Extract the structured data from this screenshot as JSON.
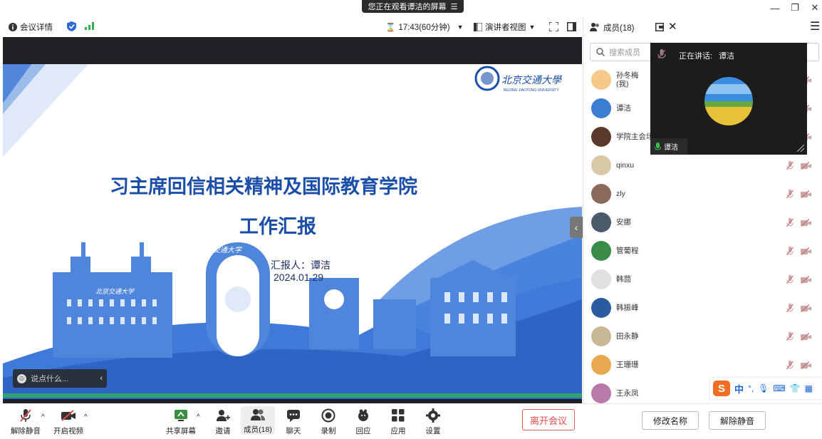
{
  "banner": {
    "text": "您正在观看谭洁的屏幕"
  },
  "toolbar": {
    "meeting_info": "会议详情",
    "timer": "17:43(60分钟)",
    "view_mode": "演讲者视图"
  },
  "slide": {
    "title_line1": "习主席回信相关精神及国际教育学院",
    "title_line2": "工作汇报",
    "reporter": "汇报人：谭洁",
    "date": "2024.01.29",
    "logo_text": "北京交通大學",
    "logo_sub": "BEIJING JIAOTONG UNIVERSITY",
    "building_caption": "北京交通大学",
    "arch_caption": "交通大学"
  },
  "chat_input": {
    "placeholder": "说点什么..."
  },
  "bottom_bar": {
    "unmute": "解除静音",
    "start_video": "开启视频",
    "share_screen": "共享屏幕",
    "invite": "邀请",
    "members": "成员(18)",
    "chat": "聊天",
    "record": "录制",
    "reactions": "回应",
    "apps": "应用",
    "settings": "设置",
    "leave": "离开会议"
  },
  "panel": {
    "title": "成员(18)",
    "search_placeholder": "搜索成员",
    "speaking_label": "正在讲话:",
    "speaking_name": "谭洁",
    "video_name": "谭洁",
    "rename_button": "修改名称",
    "unmute_button": "解除静音",
    "members": [
      {
        "name": "孙冬梅",
        "sub": "(我)"
      },
      {
        "name": "谭洁",
        "sub": ""
      },
      {
        "name": "学院主会场",
        "sub": ""
      },
      {
        "name": "qinxu",
        "sub": ""
      },
      {
        "name": "zly",
        "sub": ""
      },
      {
        "name": "安娜",
        "sub": ""
      },
      {
        "name": "管葡程",
        "sub": ""
      },
      {
        "name": "韩茴",
        "sub": ""
      },
      {
        "name": "韩振峰",
        "sub": ""
      },
      {
        "name": "田永静",
        "sub": ""
      },
      {
        "name": "王珊珊",
        "sub": ""
      },
      {
        "name": "王永凤",
        "sub": ""
      }
    ]
  },
  "ime": {
    "lang": "中"
  },
  "colors": {
    "accent": "#1b4ea8",
    "leave": "#e24b4b",
    "signal": "#2fb34a"
  }
}
